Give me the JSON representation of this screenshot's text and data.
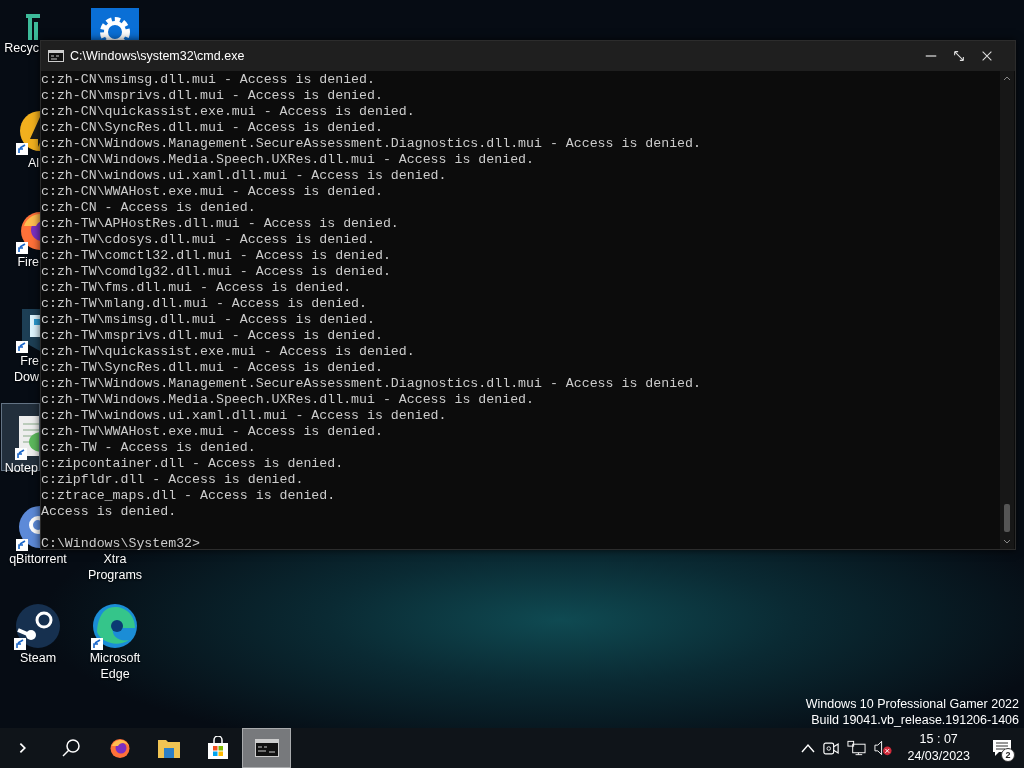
{
  "desktop_icons": [
    {
      "kind": "recycle-bin",
      "label": [
        "Recyc"
      ],
      "selected": false
    },
    {
      "kind": "settings",
      "selected": false
    },
    {
      "kind": "app",
      "label": [
        "Al"
      ],
      "shortcut": true,
      "selected": false
    },
    {
      "kind": "firefox",
      "label": [
        "Fire"
      ],
      "shortcut": true,
      "selected": false
    },
    {
      "kind": "download",
      "label": [
        "Fre",
        "Dow"
      ],
      "shortcut": true,
      "selected": false
    },
    {
      "kind": "notepad",
      "label": [
        "Notep"
      ],
      "shortcut": true,
      "selected": true
    },
    {
      "kind": "qbittorrent",
      "label": [
        "qBittorrent"
      ],
      "shortcut": true,
      "selected": false
    },
    {
      "label": [
        "Xtra",
        "Programs"
      ],
      "selected": false
    },
    {
      "kind": "steam",
      "label": [
        "Steam"
      ],
      "shortcut": true,
      "selected": false
    },
    {
      "kind": "edge",
      "label": [
        "Microsoft",
        "Edge"
      ],
      "shortcut": true,
      "selected": false
    }
  ],
  "window": {
    "title": "C:\\Windows\\system32\\cmd.exe",
    "lines": [
      "c:zh-CN\\msimsg.dll.mui - Access is denied.",
      "c:zh-CN\\msprivs.dll.mui - Access is denied.",
      "c:zh-CN\\quickassist.exe.mui - Access is denied.",
      "c:zh-CN\\SyncRes.dll.mui - Access is denied.",
      "c:zh-CN\\Windows.Management.SecureAssessment.Diagnostics.dll.mui - Access is denied.",
      "c:zh-CN\\Windows.Media.Speech.UXRes.dll.mui - Access is denied.",
      "c:zh-CN\\windows.ui.xaml.dll.mui - Access is denied.",
      "c:zh-CN\\WWAHost.exe.mui - Access is denied.",
      "c:zh-CN - Access is denied.",
      "c:zh-TW\\APHostRes.dll.mui - Access is denied.",
      "c:zh-TW\\cdosys.dll.mui - Access is denied.",
      "c:zh-TW\\comctl32.dll.mui - Access is denied.",
      "c:zh-TW\\comdlg32.dll.mui - Access is denied.",
      "c:zh-TW\\fms.dll.mui - Access is denied.",
      "c:zh-TW\\mlang.dll.mui - Access is denied.",
      "c:zh-TW\\msimsg.dll.mui - Access is denied.",
      "c:zh-TW\\msprivs.dll.mui - Access is denied.",
      "c:zh-TW\\quickassist.exe.mui - Access is denied.",
      "c:zh-TW\\SyncRes.dll.mui - Access is denied.",
      "c:zh-TW\\Windows.Management.SecureAssessment.Diagnostics.dll.mui - Access is denied.",
      "c:zh-TW\\Windows.Media.Speech.UXRes.dll.mui - Access is denied.",
      "c:zh-TW\\windows.ui.xaml.dll.mui - Access is denied.",
      "c:zh-TW\\WWAHost.exe.mui - Access is denied.",
      "c:zh-TW - Access is denied.",
      "c:zipcontainer.dll - Access is denied.",
      "c:zipfldr.dll - Access is denied.",
      "c:ztrace_maps.dll - Access is denied.",
      "Access is denied."
    ],
    "prompt": "C:\\Windows\\System32>"
  },
  "desktop_watermark": [
    "Windows 10 Professional Gamer 2022",
    "Build 19041.vb_release.191206-1406"
  ],
  "taskbar": {
    "items": [
      {
        "kind": "chevron",
        "selected": false
      },
      {
        "kind": "search",
        "selected": false
      },
      {
        "kind": "firefox",
        "selected": false
      },
      {
        "kind": "explorer",
        "selected": false
      },
      {
        "kind": "store",
        "selected": false
      },
      {
        "kind": "terminal",
        "selected": true
      }
    ],
    "tray": [
      {
        "kind": "up"
      },
      {
        "kind": "camera"
      },
      {
        "kind": "network"
      },
      {
        "kind": "volume-muted"
      }
    ],
    "time": "15 : 07",
    "date": "24/03/2023",
    "notifications": "2"
  }
}
